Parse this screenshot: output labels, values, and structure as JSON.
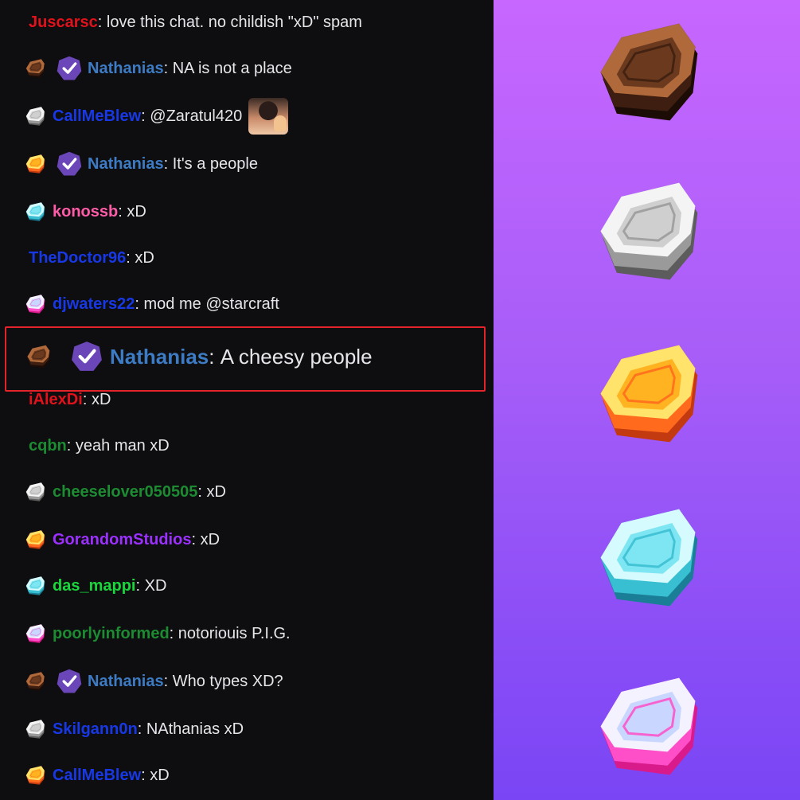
{
  "chat": {
    "messages": [
      {
        "badge": "",
        "mod": false,
        "user": "Juscarsc",
        "color": "#e0121b",
        "text": "love this chat. no childish \"xD\" spam"
      },
      {
        "badge": "bronze",
        "mod": true,
        "user": "Nathanias",
        "color": "#3d7cc4",
        "text": "NA is not a place"
      },
      {
        "badge": "silver",
        "mod": false,
        "user": "CallMeBlew",
        "color": "#1838e6",
        "text": "@Zaratul420",
        "emote": "waving-woman-emote"
      },
      {
        "badge": "gold",
        "mod": true,
        "user": "Nathanias",
        "color": "#3d7cc4",
        "text": "It's a people"
      },
      {
        "badge": "cyan",
        "mod": false,
        "user": "konossb",
        "color": "#ff5ca8",
        "text": "xD"
      },
      {
        "badge": "",
        "mod": false,
        "user": "TheDoctor96",
        "color": "#1838e6",
        "text": "xD"
      },
      {
        "badge": "pink",
        "mod": false,
        "user": "djwaters22",
        "color": "#1838e6",
        "text": "mod me @starcraft"
      },
      {
        "badge": "bronze",
        "mod": true,
        "user": "Nathanias",
        "color": "#3d7cc4",
        "text": "A cheesy people",
        "featured": true
      },
      {
        "badge": "",
        "mod": false,
        "user": "iAlexDi",
        "color": "#e0121b",
        "text": "xD"
      },
      {
        "badge": "",
        "mod": false,
        "user": "cqbn",
        "color": "#1c8b32",
        "text": "yeah man xD"
      },
      {
        "badge": "silver",
        "mod": false,
        "user": "cheeselover050505",
        "color": "#1c8b32",
        "text": "xD"
      },
      {
        "badge": "gold",
        "mod": false,
        "user": "GorandomStudios",
        "color": "#9b30ff",
        "text": "xD"
      },
      {
        "badge": "cyan",
        "mod": false,
        "user": "das_mappi",
        "color": "#19d63c",
        "text": "XD"
      },
      {
        "badge": "pink",
        "mod": false,
        "user": "poorlyinformed",
        "color": "#1c8b32",
        "text": "notoriouis P.I.G."
      },
      {
        "badge": "bronze",
        "mod": true,
        "user": "Nathanias",
        "color": "#3d7cc4",
        "text": "Who types XD?"
      },
      {
        "badge": "silver",
        "mod": false,
        "user": "Skilgann0n",
        "color": "#1838e6",
        "text": "NAthanias xD"
      },
      {
        "badge": "gold",
        "mod": false,
        "user": "CallMeBlew",
        "color": "#1838e6",
        "text": "xD"
      }
    ]
  },
  "gems": [
    "bronze",
    "silver",
    "gold",
    "cyan",
    "pink"
  ],
  "palettes": {
    "bronze": {
      "top": "#b0693a",
      "face": "#6b3a1e",
      "side": "#3d1e10",
      "edge": "#1c0c06"
    },
    "silver": {
      "top": "#f4f4f4",
      "face": "#cfcfcf",
      "side": "#9a9a9a",
      "edge": "#5c5c5c"
    },
    "gold": {
      "top": "#ffe36a",
      "face": "#ffb321",
      "side": "#ff6a1c",
      "edge": "#c43a10"
    },
    "cyan": {
      "top": "#d6fbff",
      "face": "#7ee6f2",
      "side": "#39bfd2",
      "edge": "#1a7f96"
    },
    "pink": {
      "top": "#f4f2ff",
      "face": "#c9d6ff",
      "side": "#ff4fc8",
      "edge": "#d91a8a"
    }
  },
  "colors": {
    "chat_background": "#0e0e10",
    "message_text": "#e6e6ea",
    "mod_badge": "#6b46b8",
    "highlight_border": "#e3232a"
  }
}
